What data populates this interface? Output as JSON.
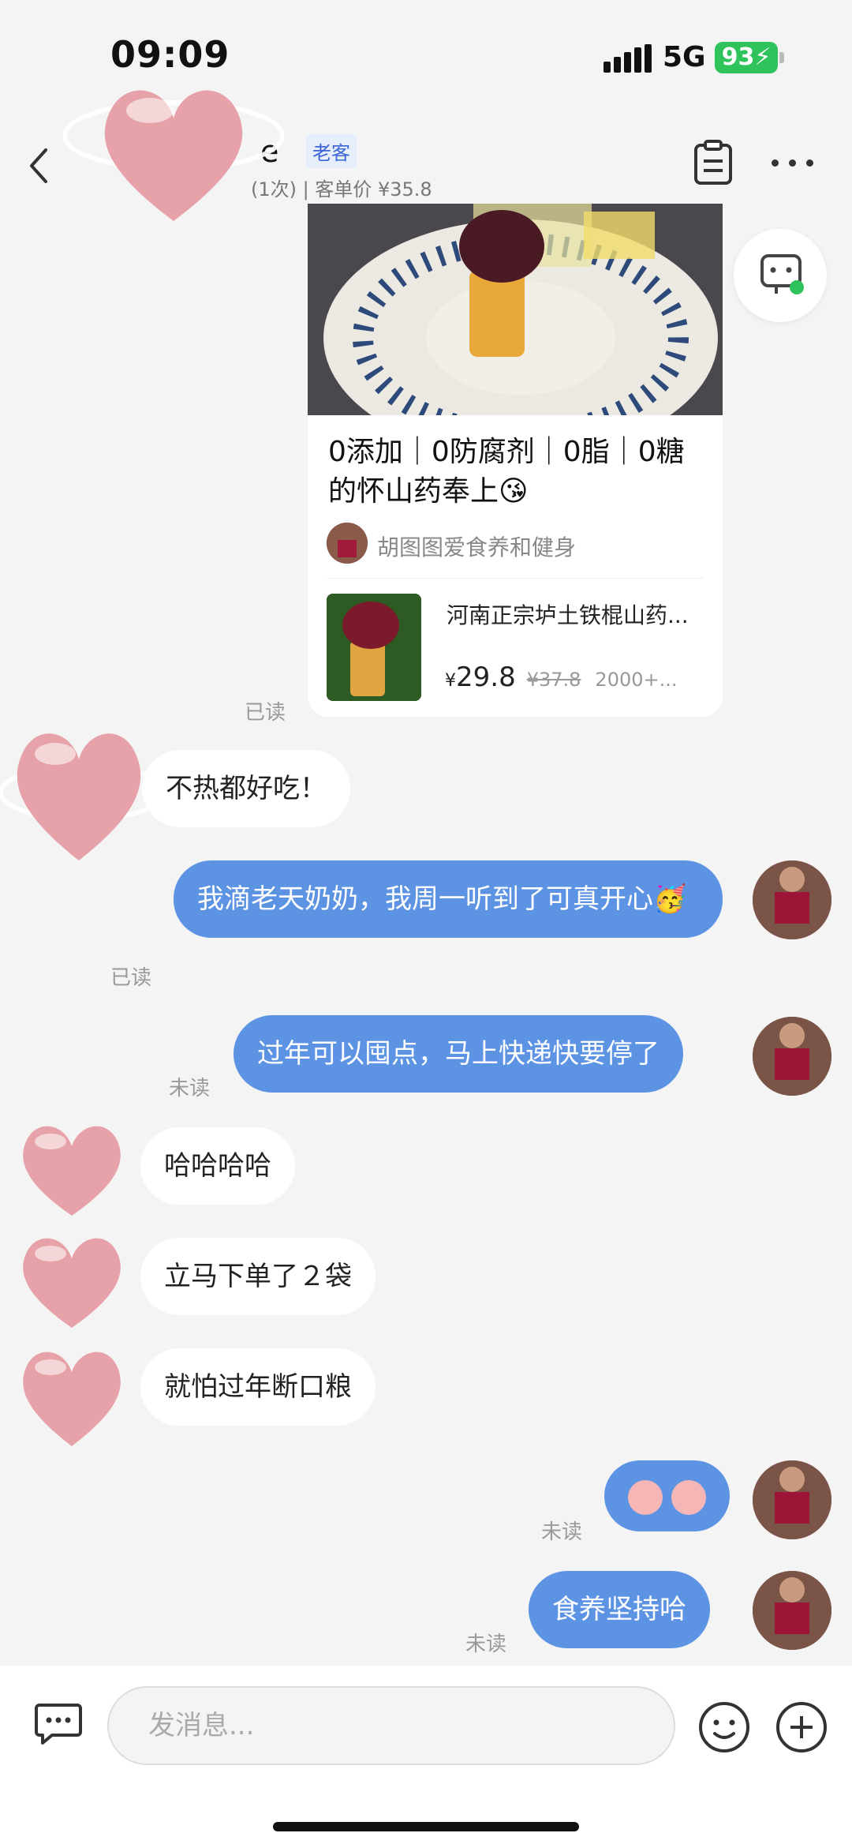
{
  "status_bar": {
    "time": "09:09",
    "network": "5G",
    "battery": "93"
  },
  "header": {
    "contact_name_partial": "e",
    "customer_tag": "老客",
    "contact_sub": "(1次) | 客单价 ¥35.8"
  },
  "product_card": {
    "title": "0添加｜0防腐剂｜0脂｜0糖 的怀山药奉上😘",
    "author": "胡图图爱食养和健身",
    "goods_name": "河南正宗垆土铁棍山药...",
    "currency": "¥",
    "price": "29.8",
    "original_price": "¥37.8",
    "sales": "2000+..."
  },
  "messages": [
    {
      "side": "receipt",
      "text": "已读"
    },
    {
      "side": "in",
      "text": "不热都好吃！"
    },
    {
      "side": "out",
      "text": "我滴老天奶奶，我周一听到了可真开心🥳",
      "receipt": "已读"
    },
    {
      "side": "out",
      "text": "过年可以囤点，马上快递快要停了",
      "receipt": "未读"
    },
    {
      "side": "in",
      "text": "哈哈哈哈"
    },
    {
      "side": "in",
      "text": "立马下单了２袋"
    },
    {
      "side": "in",
      "text": "就怕过年断口粮"
    },
    {
      "side": "out",
      "text": "[sticker]",
      "receipt": "未读"
    },
    {
      "side": "out",
      "text": "食养坚持哈",
      "receipt": "未读"
    }
  ],
  "input_bar": {
    "placeholder": "发消息..."
  },
  "colors": {
    "accent_bubble": "#5c93e3",
    "battery": "#2fc35c",
    "tag_text": "#3b66d6"
  }
}
